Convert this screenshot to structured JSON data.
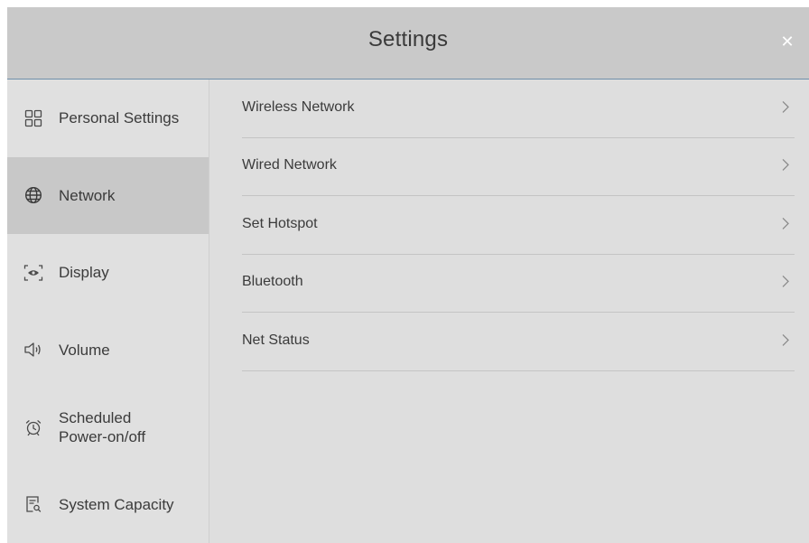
{
  "window": {
    "title": "Settings",
    "close_glyph": "✕"
  },
  "sidebar": {
    "items": [
      {
        "label": "Personal Settings",
        "icon": "grid-icon",
        "active": false
      },
      {
        "label": "Network",
        "icon": "globe-icon",
        "active": true
      },
      {
        "label": "Display",
        "icon": "display-eye-icon",
        "active": false
      },
      {
        "label": "Volume",
        "icon": "speaker-icon",
        "active": false
      },
      {
        "label": "Scheduled\nPower-on/off",
        "icon": "alarm-clock-icon",
        "active": false
      },
      {
        "label": "System Capacity",
        "icon": "document-search-icon",
        "active": false
      }
    ]
  },
  "network": {
    "items": [
      {
        "label": "Wireless Network",
        "icon": "chevron-right-icon"
      },
      {
        "label": "Wired Network",
        "icon": "chevron-right-icon"
      },
      {
        "label": "Set Hotspot",
        "icon": "chevron-right-icon"
      },
      {
        "label": "Bluetooth",
        "icon": "chevron-right-icon"
      },
      {
        "label": "Net Status",
        "icon": "chevron-right-icon"
      }
    ]
  },
  "colors": {
    "titlebar_bg": "#c9c9c9",
    "title_underline": "#6f8faa",
    "panel_bg": "#dedede",
    "sidebar_active_bg": "#c8c8c8",
    "divider": "#c4c4c4",
    "text": "#3b3b3b"
  }
}
